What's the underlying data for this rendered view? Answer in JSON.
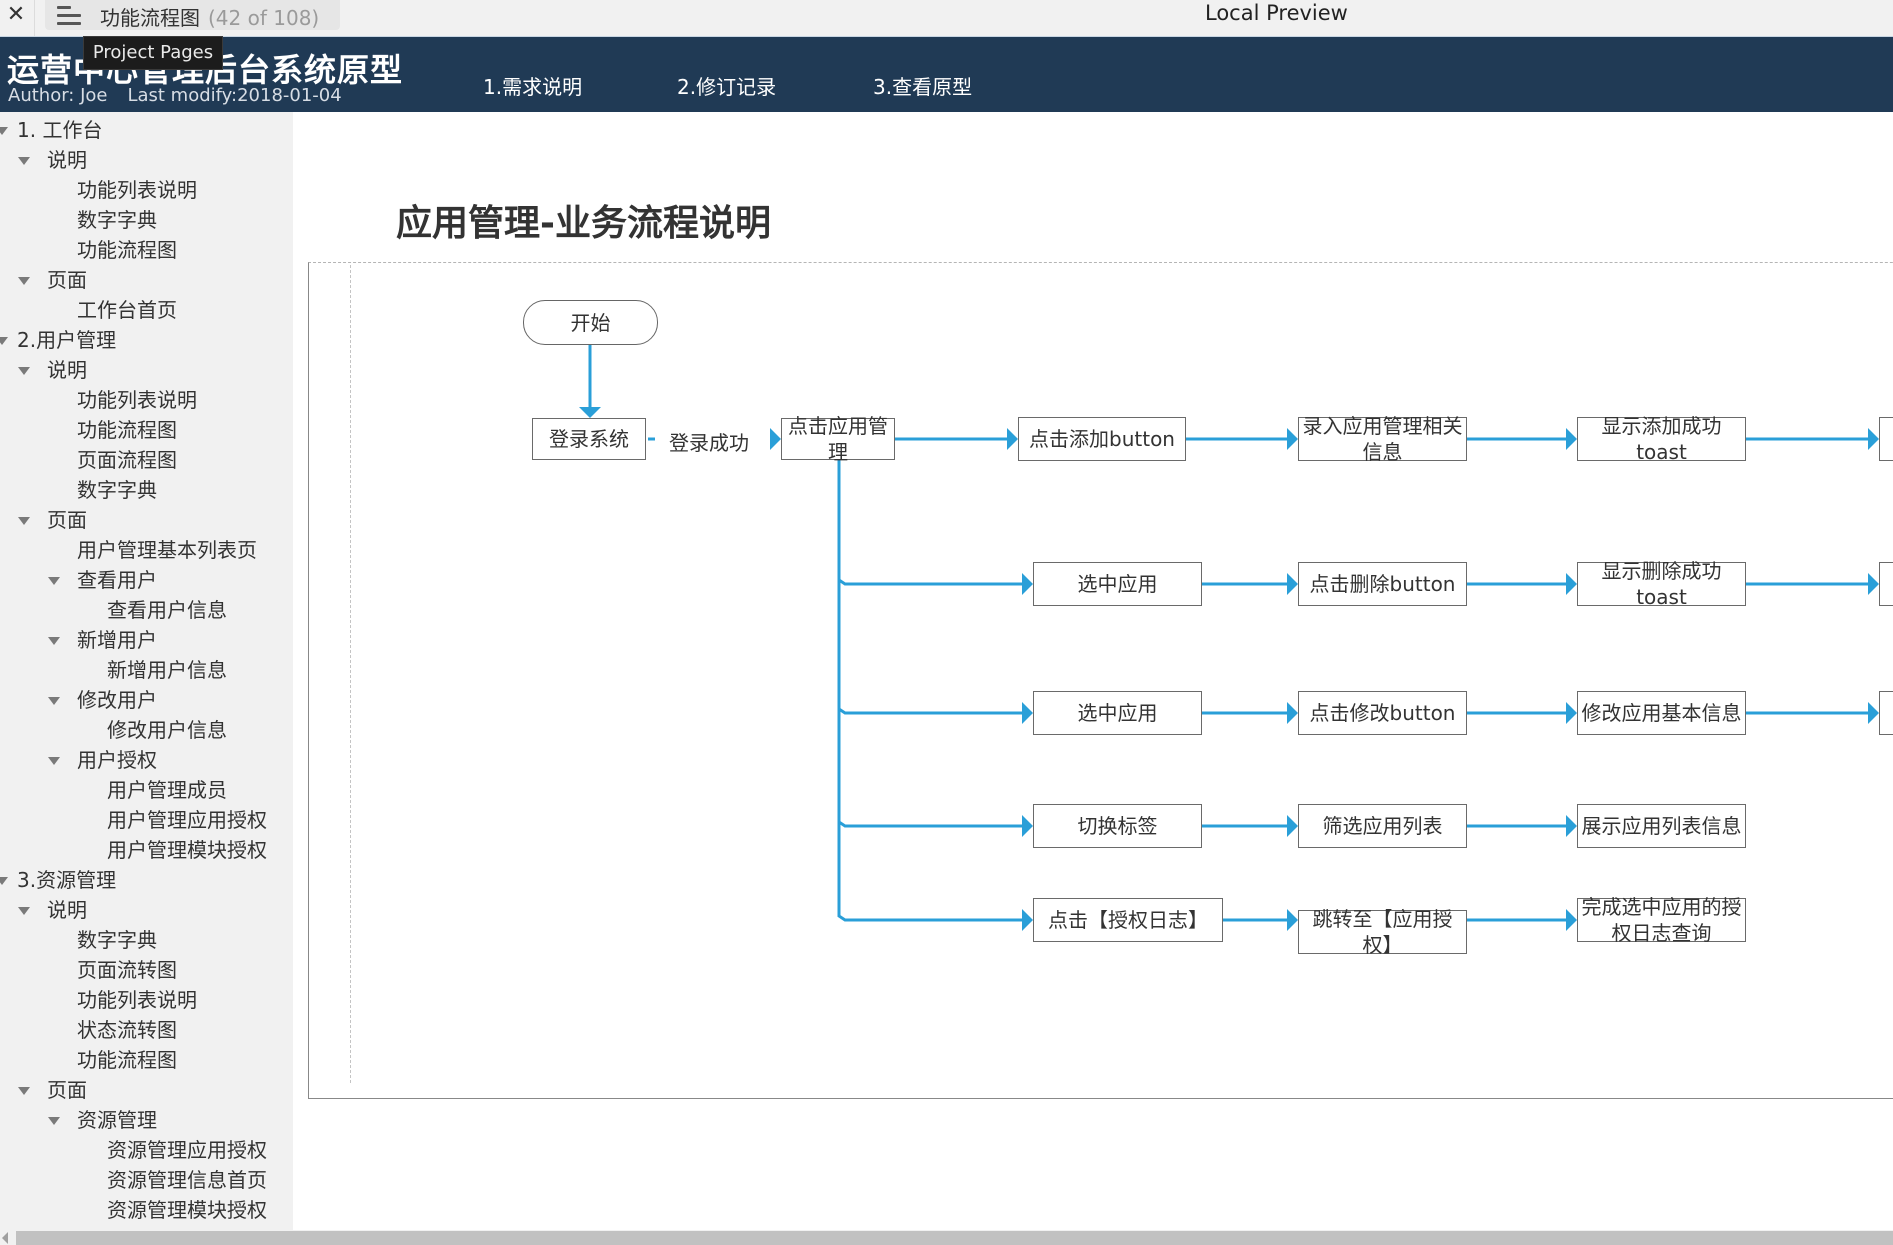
{
  "topbar": {
    "close_icon": "close-icon",
    "menu_icon": "hamburger-menu-icon",
    "page_name": "功能流程图",
    "page_count": "(42 of 108)",
    "window_title": "Local Preview"
  },
  "tooltip": {
    "text": "Project Pages"
  },
  "header": {
    "title": "运营中心管理后台系统原型",
    "author": "Author: Joe",
    "last_modify": "Last modify:2018-01-04",
    "nav": [
      {
        "label": "1.需求说明"
      },
      {
        "label": "2.修订记录"
      },
      {
        "label": "3.查看原型"
      }
    ]
  },
  "sidebar": {
    "items": [
      {
        "label": "1. 工作台",
        "level": 0,
        "expanded": true
      },
      {
        "label": "说明",
        "level": 1,
        "expanded": true
      },
      {
        "label": "功能列表说明",
        "level": 2
      },
      {
        "label": "数字字典",
        "level": 2
      },
      {
        "label": "功能流程图",
        "level": 2
      },
      {
        "label": "页面",
        "level": 1,
        "expanded": true
      },
      {
        "label": "工作台首页",
        "level": 2
      },
      {
        "label": "2.用户管理",
        "level": 0,
        "expanded": true
      },
      {
        "label": "说明",
        "level": 1,
        "expanded": true
      },
      {
        "label": "功能列表说明",
        "level": 2
      },
      {
        "label": "功能流程图",
        "level": 2
      },
      {
        "label": "页面流程图",
        "level": 2
      },
      {
        "label": "数字字典",
        "level": 2
      },
      {
        "label": "页面",
        "level": 1,
        "expanded": true
      },
      {
        "label": "用户管理基本列表页",
        "level": 2
      },
      {
        "label": "查看用户",
        "level": 2,
        "expanded": true
      },
      {
        "label": "查看用户信息",
        "level": 3
      },
      {
        "label": "新增用户",
        "level": 2,
        "expanded": true
      },
      {
        "label": "新增用户信息",
        "level": 3
      },
      {
        "label": "修改用户",
        "level": 2,
        "expanded": true
      },
      {
        "label": "修改用户信息",
        "level": 3
      },
      {
        "label": "用户授权",
        "level": 2,
        "expanded": true
      },
      {
        "label": "用户管理成员",
        "level": 3
      },
      {
        "label": "用户管理应用授权",
        "level": 3
      },
      {
        "label": "用户管理模块授权",
        "level": 3
      },
      {
        "label": "3.资源管理",
        "level": 0,
        "expanded": true
      },
      {
        "label": "说明",
        "level": 1,
        "expanded": true
      },
      {
        "label": "数字字典",
        "level": 2
      },
      {
        "label": "页面流转图",
        "level": 2
      },
      {
        "label": "功能列表说明",
        "level": 2
      },
      {
        "label": "状态流转图",
        "level": 2
      },
      {
        "label": "功能流程图",
        "level": 2
      },
      {
        "label": "页面",
        "level": 1,
        "expanded": true
      },
      {
        "label": "资源管理",
        "level": 2,
        "expanded": true
      },
      {
        "label": "资源管理应用授权",
        "level": 3
      },
      {
        "label": "资源管理信息首页",
        "level": 3
      },
      {
        "label": "资源管理模块授权",
        "level": 3
      }
    ]
  },
  "main": {
    "heading": "应用管理-业务流程说明",
    "flow": {
      "accent_color": "#2a9fd8",
      "start": "开始",
      "login": "登录系统",
      "login_success_label": "登录成功",
      "click_app_mgmt": "点击应用管理",
      "rows": [
        {
          "steps": [
            "点击添加button",
            "录入应用管理相关信息",
            "显示添加成功toast"
          ],
          "continues": true
        },
        {
          "steps": [
            "选中应用",
            "点击删除button",
            "显示删除成功toast"
          ],
          "continues": true
        },
        {
          "steps": [
            "选中应用",
            "点击修改button",
            "修改应用基本信息"
          ],
          "continues": true
        },
        {
          "steps": [
            "切换标签",
            "筛选应用列表",
            "展示应用列表信息"
          ],
          "continues": false
        },
        {
          "steps": [
            "点击【授权日志】",
            "跳转至【应用授权】",
            "完成选中应用的授权日志查询"
          ],
          "continues": false
        }
      ]
    }
  }
}
